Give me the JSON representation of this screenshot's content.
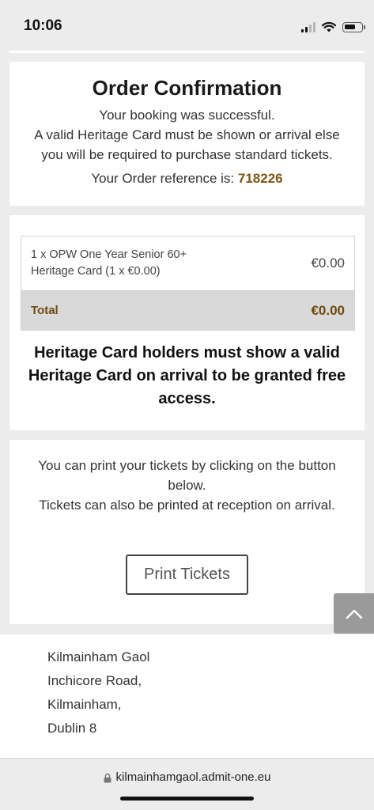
{
  "status_bar": {
    "time": "10:06",
    "battery_level": 0.7,
    "signal_bars": 2,
    "signal_bars_total": 4
  },
  "confirmation": {
    "title": "Order Confirmation",
    "line1": "Your booking was successful.",
    "line2": "A valid Heritage Card must be shown or arrival else",
    "line3": "you will be required to purchase standard tickets.",
    "ref_label": "Your Order reference is:",
    "ref_value": "718226"
  },
  "order": {
    "items": [
      {
        "description": "1 x OPW One Year Senior 60+ Heritage Card (1 x €0.00)",
        "price": "€0.00"
      }
    ],
    "total_label": "Total",
    "total_value": "€0.00",
    "heritage_note": "Heritage Card holders must show a valid Heritage Card on arrival to be granted free access."
  },
  "print": {
    "line1": "You can print your tickets by clicking on the button below.",
    "line2": "Tickets can also be printed at reception on arrival.",
    "button_label": "Print Tickets"
  },
  "footer": {
    "address": [
      "Kilmainham Gaol",
      "Inchicore Road,",
      "Kilmainham,",
      "Dublin 8"
    ]
  },
  "browser": {
    "url": "kilmainhamgaol.admit-one.eu"
  },
  "icons": {
    "scroll_top": "chevron-up-icon",
    "lock": "lock-icon",
    "wifi": "wifi-icon",
    "battery": "battery-icon",
    "signal": "signal-icon"
  },
  "colors": {
    "accent_brown": "#7a5510",
    "total_row_bg": "#d9d9d9",
    "scroll_button_bg": "#9a9a9a"
  }
}
